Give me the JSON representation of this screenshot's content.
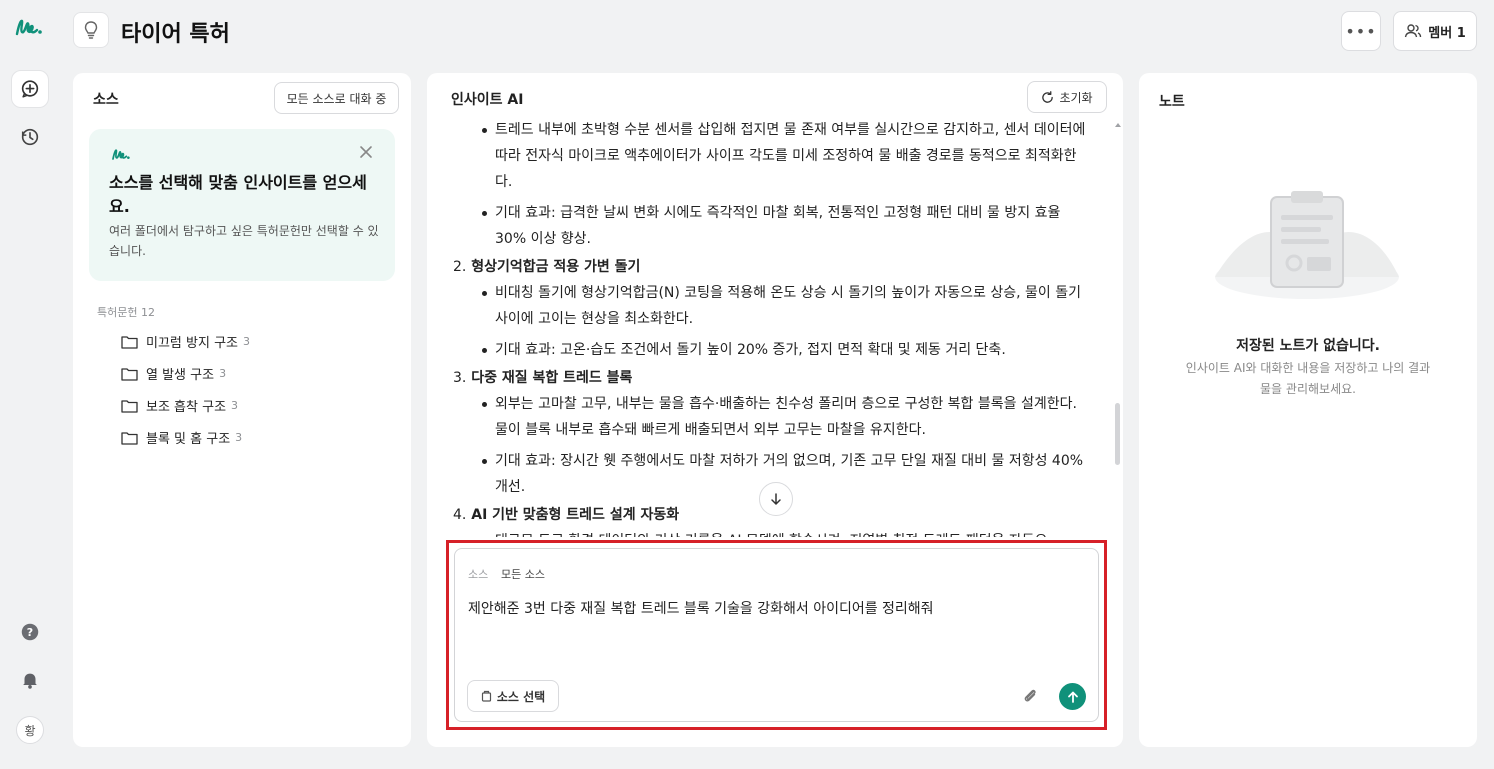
{
  "header": {
    "title": "타이어 특허",
    "more_label": "•••",
    "member_label": "멤버 1"
  },
  "rail": {
    "avatar_initial": "황"
  },
  "source_panel": {
    "title": "소스",
    "all_sources_button": "모든 소스로 대화 중",
    "tip": {
      "title": "소스를 선택해 맞춤 인사이트를 얻으세요.",
      "description": "여러 폴더에서 탐구하고 싶은 특허문헌만 선택할 수 있습니다."
    },
    "folder_header": "특허문헌 12",
    "folders": [
      {
        "name": "미끄럼 방지 구조",
        "count": "3"
      },
      {
        "name": "열 발생 구조",
        "count": "3"
      },
      {
        "name": "보조 흡착 구조",
        "count": "3"
      },
      {
        "name": "블록 및 홈 구조",
        "count": "3"
      }
    ]
  },
  "chat_panel": {
    "title": "인사이트 AI",
    "reset_label": "초기화",
    "lines": {
      "l1": "트레드 내부에 초박형 수분 센서를 삽입해 접지면 물 존재 여부를 실시간으로 감지하고, 센서 데이터에 따라 전자식 마이크로 액추에이터가 사이프 각도를 미세 조정하여 물 배출 경로를 동적으로 최적화한다.",
      "l2": "기대 효과: 급격한 날씨 변화 시에도 즉각적인 마찰 회복, 전통적인 고정형 패턴 대비 물 방지 효율 30% 이상 향상.",
      "h2_num": "2.",
      "h2": "형상기억합금 적용 가변 돌기",
      "l3": "비대칭 돌기에 형상기억합금(N) 코팅을 적용해 온도 상승 시 돌기의 높이가 자동으로 상승, 물이 돌기 사이에 고이는 현상을 최소화한다.",
      "l4": "기대 효과: 고온·습도 조건에서 돌기 높이 20% 증가, 접지 면적 확대 및 제동 거리 단축.",
      "h3_num": "3.",
      "h3": "다중 재질 복합 트레드 블록",
      "l5": "외부는 고마찰 고무, 내부는 물을 흡수·배출하는 친수성 폴리머 층으로 구성한 복합 블록을 설계한다. 물이 블록 내부로 흡수돼 빠르게 배출되면서 외부 고무는 마찰을 유지한다.",
      "l6": "기대 효과: 장시간 웻 주행에서도 마찰 저하가 거의 없으며, 기존 고무 단일 재질 대비 물 저항성 40% 개선.",
      "h4_num": "4.",
      "h4": "AI 기반 맞춤형 트레드 설계 자동화",
      "l7": "대규모 도로 환경 데이터와 기상 기록을 AI 모델에 학습시켜, 지역별 최적 트레드 패턴을 자동으"
    },
    "input": {
      "source_label": "소스",
      "source_value": "모든 소스",
      "text": "제안해준 3번 다중 재질 복합 트레드 블록 기술을 강화해서 아이디어를 정리해줘",
      "select_source_button": "소스 선택"
    }
  },
  "note_panel": {
    "title": "노트",
    "empty_title": "저장된 노트가 없습니다.",
    "empty_desc": "인사이트 AI와 대화한 내용을 저장하고 나의 결과물을 관리해보세요."
  },
  "colors": {
    "accent": "#10917a",
    "highlight_border": "#d62028",
    "tip_bg": "#eef8f5"
  }
}
